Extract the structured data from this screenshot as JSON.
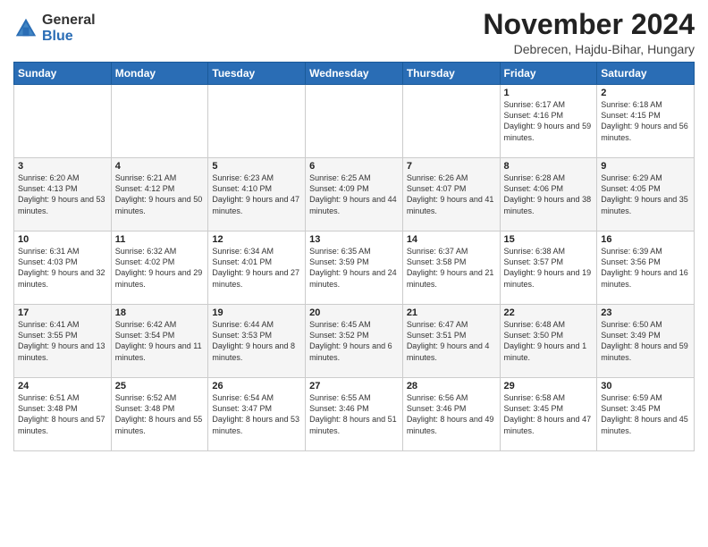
{
  "logo": {
    "general": "General",
    "blue": "Blue"
  },
  "title": "November 2024",
  "subtitle": "Debrecen, Hajdu-Bihar, Hungary",
  "days_of_week": [
    "Sunday",
    "Monday",
    "Tuesday",
    "Wednesday",
    "Thursday",
    "Friday",
    "Saturday"
  ],
  "weeks": [
    [
      {
        "day": "",
        "info": ""
      },
      {
        "day": "",
        "info": ""
      },
      {
        "day": "",
        "info": ""
      },
      {
        "day": "",
        "info": ""
      },
      {
        "day": "",
        "info": ""
      },
      {
        "day": "1",
        "info": "Sunrise: 6:17 AM\nSunset: 4:16 PM\nDaylight: 9 hours and 59 minutes."
      },
      {
        "day": "2",
        "info": "Sunrise: 6:18 AM\nSunset: 4:15 PM\nDaylight: 9 hours and 56 minutes."
      }
    ],
    [
      {
        "day": "3",
        "info": "Sunrise: 6:20 AM\nSunset: 4:13 PM\nDaylight: 9 hours and 53 minutes."
      },
      {
        "day": "4",
        "info": "Sunrise: 6:21 AM\nSunset: 4:12 PM\nDaylight: 9 hours and 50 minutes."
      },
      {
        "day": "5",
        "info": "Sunrise: 6:23 AM\nSunset: 4:10 PM\nDaylight: 9 hours and 47 minutes."
      },
      {
        "day": "6",
        "info": "Sunrise: 6:25 AM\nSunset: 4:09 PM\nDaylight: 9 hours and 44 minutes."
      },
      {
        "day": "7",
        "info": "Sunrise: 6:26 AM\nSunset: 4:07 PM\nDaylight: 9 hours and 41 minutes."
      },
      {
        "day": "8",
        "info": "Sunrise: 6:28 AM\nSunset: 4:06 PM\nDaylight: 9 hours and 38 minutes."
      },
      {
        "day": "9",
        "info": "Sunrise: 6:29 AM\nSunset: 4:05 PM\nDaylight: 9 hours and 35 minutes."
      }
    ],
    [
      {
        "day": "10",
        "info": "Sunrise: 6:31 AM\nSunset: 4:03 PM\nDaylight: 9 hours and 32 minutes."
      },
      {
        "day": "11",
        "info": "Sunrise: 6:32 AM\nSunset: 4:02 PM\nDaylight: 9 hours and 29 minutes."
      },
      {
        "day": "12",
        "info": "Sunrise: 6:34 AM\nSunset: 4:01 PM\nDaylight: 9 hours and 27 minutes."
      },
      {
        "day": "13",
        "info": "Sunrise: 6:35 AM\nSunset: 3:59 PM\nDaylight: 9 hours and 24 minutes."
      },
      {
        "day": "14",
        "info": "Sunrise: 6:37 AM\nSunset: 3:58 PM\nDaylight: 9 hours and 21 minutes."
      },
      {
        "day": "15",
        "info": "Sunrise: 6:38 AM\nSunset: 3:57 PM\nDaylight: 9 hours and 19 minutes."
      },
      {
        "day": "16",
        "info": "Sunrise: 6:39 AM\nSunset: 3:56 PM\nDaylight: 9 hours and 16 minutes."
      }
    ],
    [
      {
        "day": "17",
        "info": "Sunrise: 6:41 AM\nSunset: 3:55 PM\nDaylight: 9 hours and 13 minutes."
      },
      {
        "day": "18",
        "info": "Sunrise: 6:42 AM\nSunset: 3:54 PM\nDaylight: 9 hours and 11 minutes."
      },
      {
        "day": "19",
        "info": "Sunrise: 6:44 AM\nSunset: 3:53 PM\nDaylight: 9 hours and 8 minutes."
      },
      {
        "day": "20",
        "info": "Sunrise: 6:45 AM\nSunset: 3:52 PM\nDaylight: 9 hours and 6 minutes."
      },
      {
        "day": "21",
        "info": "Sunrise: 6:47 AM\nSunset: 3:51 PM\nDaylight: 9 hours and 4 minutes."
      },
      {
        "day": "22",
        "info": "Sunrise: 6:48 AM\nSunset: 3:50 PM\nDaylight: 9 hours and 1 minute."
      },
      {
        "day": "23",
        "info": "Sunrise: 6:50 AM\nSunset: 3:49 PM\nDaylight: 8 hours and 59 minutes."
      }
    ],
    [
      {
        "day": "24",
        "info": "Sunrise: 6:51 AM\nSunset: 3:48 PM\nDaylight: 8 hours and 57 minutes."
      },
      {
        "day": "25",
        "info": "Sunrise: 6:52 AM\nSunset: 3:48 PM\nDaylight: 8 hours and 55 minutes."
      },
      {
        "day": "26",
        "info": "Sunrise: 6:54 AM\nSunset: 3:47 PM\nDaylight: 8 hours and 53 minutes."
      },
      {
        "day": "27",
        "info": "Sunrise: 6:55 AM\nSunset: 3:46 PM\nDaylight: 8 hours and 51 minutes."
      },
      {
        "day": "28",
        "info": "Sunrise: 6:56 AM\nSunset: 3:46 PM\nDaylight: 8 hours and 49 minutes."
      },
      {
        "day": "29",
        "info": "Sunrise: 6:58 AM\nSunset: 3:45 PM\nDaylight: 8 hours and 47 minutes."
      },
      {
        "day": "30",
        "info": "Sunrise: 6:59 AM\nSunset: 3:45 PM\nDaylight: 8 hours and 45 minutes."
      }
    ]
  ]
}
